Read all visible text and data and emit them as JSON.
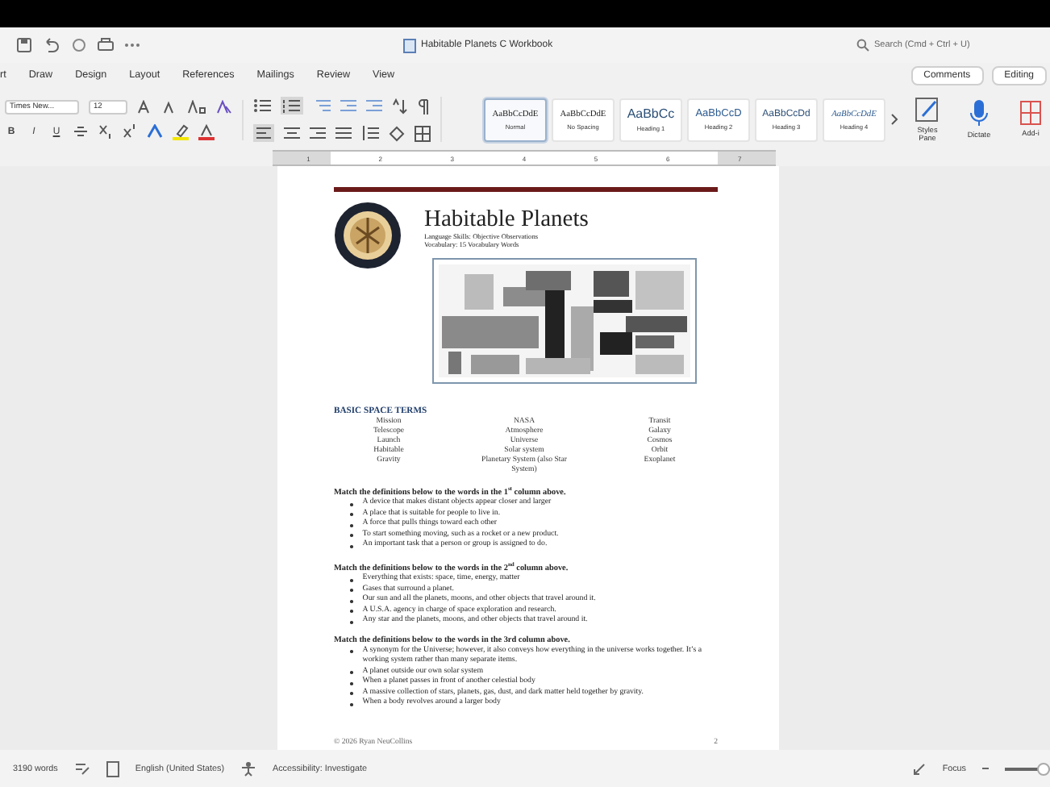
{
  "title_bar": {
    "document_title": "Habitable Planets C Workbook",
    "search": {
      "placeholder": "Search (Cmd + Ctrl + U)"
    }
  },
  "ribbon_tabs": [
    {
      "label": "rt",
      "selected": false
    },
    {
      "label": "Draw",
      "selected": false
    },
    {
      "label": "Design",
      "selected": false
    },
    {
      "label": "Layout",
      "selected": false
    },
    {
      "label": "References",
      "selected": false
    },
    {
      "label": "Mailings",
      "selected": false
    },
    {
      "label": "Review",
      "selected": false
    },
    {
      "label": "View",
      "selected": false
    }
  ],
  "ribbon_buttons": {
    "comments": "Comments",
    "editing": "Editing"
  },
  "font": {
    "family": "Times New...",
    "size": "12"
  },
  "format_buttons": [
    "B",
    "I",
    "U"
  ],
  "styles": [
    {
      "preview": "AaBbCcDdE",
      "label": "Normal",
      "selected": true,
      "kind": "normal"
    },
    {
      "preview": "AaBbCcDdE",
      "label": "No Spacing",
      "selected": false,
      "kind": "normal"
    },
    {
      "preview": "AaBbCc",
      "label": "Heading 1",
      "selected": false,
      "kind": "heading1"
    },
    {
      "preview": "AaBbCcD",
      "label": "Heading 2",
      "selected": false,
      "kind": "heading2"
    },
    {
      "preview": "AaBbCcDd",
      "label": "Heading 3",
      "selected": false,
      "kind": "heading3"
    },
    {
      "preview": "AaBbCcDdE",
      "label": "Heading 4",
      "selected": false,
      "kind": "heading4"
    }
  ],
  "ribbon_tools": [
    {
      "label": "Styles Pane",
      "kind": "styles"
    },
    {
      "label": "Dictate",
      "kind": "dictate"
    },
    {
      "label": "Add-i",
      "kind": "addins"
    }
  ],
  "ruler": [
    "1",
    "2",
    "3",
    "4",
    "5",
    "6",
    "7"
  ],
  "document": {
    "title": "Habitable Planets",
    "subtitle": [
      "Language Skills: Objective Observations",
      "Vocabulary: 15 Vocabulary Words"
    ],
    "terms_heading": "BASIC SPACE TERMS",
    "terms": [
      [
        "Mission",
        "Telescope",
        "Launch",
        "Habitable",
        "Gravity"
      ],
      [
        "NASA",
        "Atmosphere",
        "Universe",
        "Solar system",
        "Planetary System (also Star System)"
      ],
      [
        "Transit",
        "Galaxy",
        "Cosmos",
        "Orbit",
        "Exoplanet"
      ]
    ],
    "sections": [
      {
        "heading": "Match the definitions below to the words in the 1$^{st}$ column above.",
        "items": [
          "A device that makes distant objects appear closer and larger",
          "A place that is suitable for people to live in.",
          "A force that pulls things toward each other",
          "To start something moving, such as a rocket or a new product.",
          "An important task that a person or group is assigned to do."
        ]
      },
      {
        "heading": "Match the definitions below to the words in the 2$^{nd}$ column above.",
        "items": [
          "Everything that exists: space, time, energy, matter",
          "Gases that surround a planet.",
          "Our sun and all the planets, moons, and other objects that travel around it.",
          "A U.S.A. agency in charge of space exploration and research.",
          "Any star and the planets, moons, and other objects that travel around it."
        ]
      },
      {
        "heading": "Match the definitions below to the words in the 3rd column above.",
        "items": [
          "A synonym for the Universe; however, it also conveys how everything in the universe works together. It’s a working system rather than many separate items.",
          "A planet outside our own solar system",
          "When a planet passes in front of another celestial body",
          "A massive collection of stars, planets, gas, dust, and dark matter held together by gravity.",
          "When a body revolves around a larger body"
        ]
      }
    ],
    "footer": {
      "copyright": "© 2026 Ryan NeuCollins",
      "page": "2"
    }
  },
  "status_bar": {
    "word_count": "3190 words",
    "language": "English (United States)",
    "accessibility": "Accessibility: Investigate",
    "focus": "Focus",
    "zoom": {
      "level": 0.7
    }
  }
}
